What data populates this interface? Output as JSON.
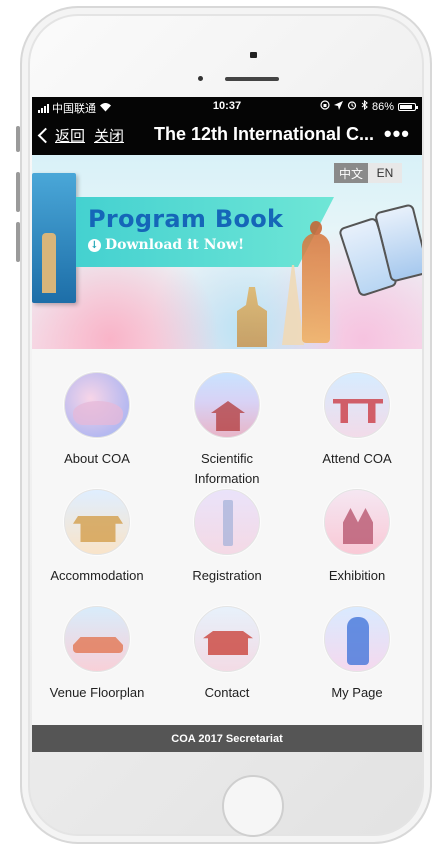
{
  "status_bar": {
    "carrier": "中国联通",
    "time": "10:37",
    "battery": "86%"
  },
  "nav": {
    "back_label": "返回",
    "close_label": "关闭",
    "title": "The 12th International C...",
    "more_label": "•••"
  },
  "banner": {
    "title": "Program Book",
    "download_label": "Download it Now!",
    "lang_zh": "中文",
    "lang_en": "EN"
  },
  "menu": [
    {
      "label": "About COA",
      "icon": "lotus-image-icon"
    },
    {
      "label": "Scientific Information",
      "icon": "temple-image-icon"
    },
    {
      "label": "Attend COA",
      "icon": "gate-image-icon"
    },
    {
      "label": "Accommodation",
      "icon": "pavilion-image-icon"
    },
    {
      "label": "Registration",
      "icon": "tower-image-icon"
    },
    {
      "label": "Exhibition",
      "icon": "palace-image-icon"
    },
    {
      "label": "Venue Floorplan",
      "icon": "bridge-image-icon"
    },
    {
      "label": "Contact",
      "icon": "gate-tower-image-icon"
    },
    {
      "label": "My Page",
      "icon": "statue-image-icon"
    }
  ],
  "footer": {
    "text": "COA 2017 Secretariat"
  },
  "colors": {
    "nav_bg": "#050505",
    "footer_bg": "#555555",
    "banner_accent": "#44d1d0",
    "title_blue": "#1566b8"
  }
}
